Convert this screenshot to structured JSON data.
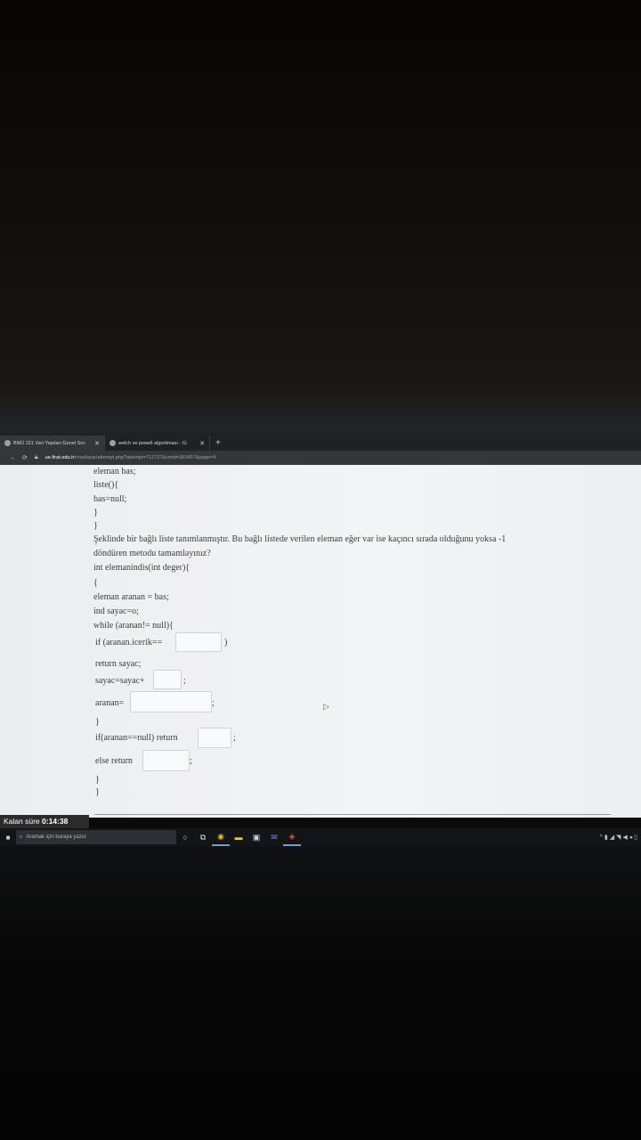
{
  "browser": {
    "tabs": [
      {
        "title": "BMÜ 221 Veri Yapıları Genel Sın:",
        "close": "✕"
      },
      {
        "title": "welch ve powell algoritması - G:",
        "close": "✕"
      }
    ],
    "new_tab": "+",
    "url_host": "ue.firat.edu.tr",
    "url_path": "/mod/quiz/attempt.php?attempt=711737&cmid=393457&page=4"
  },
  "question": {
    "lines_top": [
      "eleman bas;",
      "liste(){",
      "bas=null;",
      "}",
      "}"
    ],
    "prompt_1": "Şeklinde bir bağlı liste tanımlanmıştır. Bu bağlı listede verilen eleman eğer var ise kaçıncı sırada olduğunu yoksa -1",
    "prompt_2": "döndüren metodu tamamlayınız?",
    "method": [
      "int elemanindis(int deger){",
      "{",
      "eleman aranan = bas;",
      "ind sayac=o;",
      "while (aranan!= null){"
    ],
    "if_line": "if (aranan.icerik==",
    "if_close": ")",
    "return_sayac": "return sayac;",
    "sayac_line": "sayac=sayac+",
    "semicolon": ";",
    "aranan_line": "aranan=",
    "close_brace": "}",
    "if_null": "if(aranan==null) return",
    "else_return": "else return"
  },
  "quiz": {
    "timer_label": "Kalan süre",
    "timer_value": "0:14:38"
  },
  "taskbar": {
    "search_placeholder": "Aramak için buraya yazın",
    "tray": "^ ▮ ◢ ◥ ◀ ◂ ▯"
  }
}
